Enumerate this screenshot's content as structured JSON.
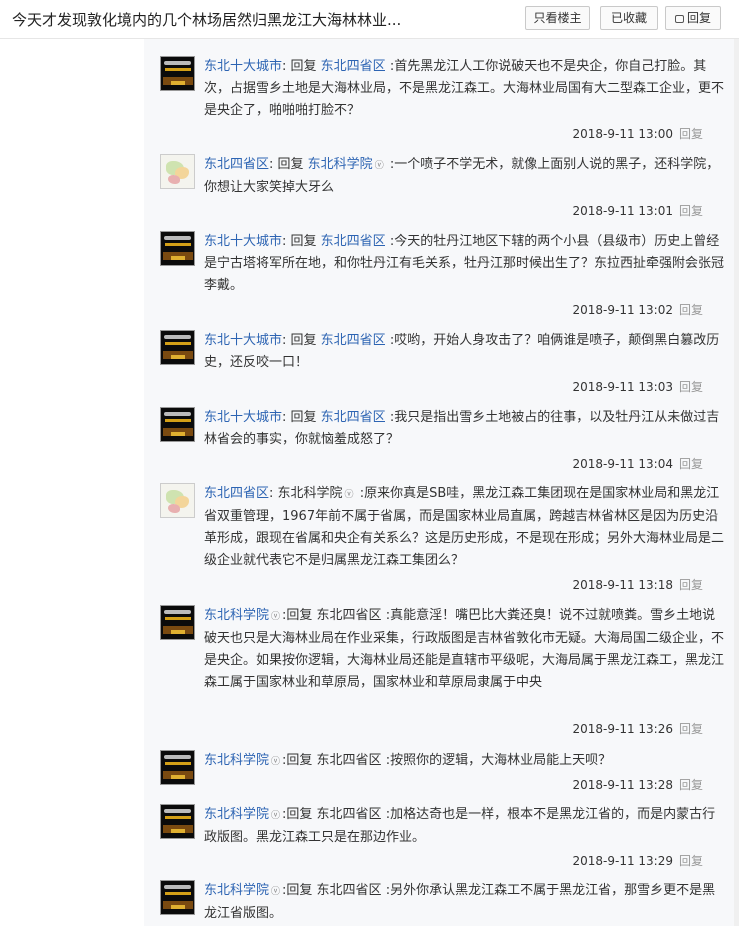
{
  "header": {
    "title": "今天才发现敦化境内的几个林场居然归黑龙江大海林林业...",
    "buttons": {
      "only_owner": "只看楼主",
      "favorited": "已收藏",
      "reply": "回复"
    }
  },
  "comments": [
    {
      "avatar_icon": "dark-night-avatar-icon",
      "name": "东北十大城市",
      "sep": ": ",
      "action": "回复 ",
      "target": "东北四省区",
      "text": " :首先黑龙江人工你说破天也不是央企，你自己打脸。其次，占据雪乡土地是大海林业局，不是黑龙江森工。大海林业局国有大二型森工企业，更不是央企了，啪啪啪打脸不？",
      "time": "2018-9-11 13:00",
      "reply": "回复"
    },
    {
      "avatar_icon": "map-avatar-icon",
      "name": "东北四省区",
      "sep": ": ",
      "action": "回复 ",
      "target": "东北科学院",
      "target_badge": "ⓥ",
      "text": " :一个喷子不学无术，就像上面别人说的黑子，还科学院，你想让大家笑掉大牙么",
      "time": "2018-9-11 13:01",
      "reply": "回复"
    },
    {
      "avatar_icon": "dark-night-avatar-icon",
      "name": "东北十大城市",
      "sep": ": ",
      "action": "回复 ",
      "target": "东北四省区",
      "text": " :今天的牡丹江地区下辖的两个小县（县级市）历史上曾经是宁古塔将军所在地，和你牡丹江有毛关系，牡丹江那时候出生了？东拉西扯牵强附会张冠李戴。",
      "time": "2018-9-11 13:02",
      "reply": "回复"
    },
    {
      "avatar_icon": "dark-night-avatar-icon",
      "name": "东北十大城市",
      "sep": ": ",
      "action": "回复 ",
      "target": "东北四省区",
      "text": " :哎哟，开始人身攻击了？咱俩谁是喷子，颠倒黑白篡改历史，还反咬一口！",
      "time": "2018-9-11 13:03",
      "reply": "回复"
    },
    {
      "avatar_icon": "dark-night-avatar-icon",
      "name": "东北十大城市",
      "sep": ": ",
      "action": "回复 ",
      "target": "东北四省区",
      "text": " :我只是指出雪乡土地被占的往事，以及牡丹江从未做过吉林省会的事实，你就恼羞成怒了？",
      "time": "2018-9-11 13:04",
      "reply": "回复"
    },
    {
      "avatar_icon": "map-avatar-icon",
      "name": "东北四省区",
      "sep": ": ",
      "action": "",
      "target": "东北科学院",
      "target_plain": true,
      "target_badge": "ⓥ",
      "text": " :原来你真是SB哇，黑龙江森工集团现在是国家林业局和黑龙江省双重管理，1967年前不属于省属，而是国家林业局直属，跨越吉林省林区是因为历史沿革形成，跟现在省属和央企有关系么？这是历史形成，不是现在形成；另外大海林业局是二级企业就代表它不是归属黑龙江森工集团么？",
      "time": "2018-9-11 13:18",
      "reply": "回复"
    },
    {
      "avatar_icon": "dark-night-avatar-icon",
      "name": "东北科学院",
      "name_badge": "ⓥ",
      "sep": " ",
      "action": ":回复 ",
      "target": "东北四省区",
      "target_plain": true,
      "text": " :真能意淫！嘴巴比大粪还臭！说不过就喷粪。雪乡土地说破天也只是大海林业局在作业采集，行政版图是吉林省敦化市无疑。大海局国二级企业，不是央企。如果按你逻辑，大海林业局还能是直辖市平级呢，大海局属于黑龙江森工，黑龙江森工属于国家林业和草原局，国家林业和草原局隶属于中央",
      "time": "2018-9-11 13:26",
      "reply": "回复"
    },
    {
      "avatar_icon": "dark-night-avatar-icon",
      "name": "东北科学院",
      "name_badge": "ⓥ",
      "sep": " ",
      "action": ":回复 ",
      "target": "东北四省区",
      "target_plain": true,
      "text": " :按照你的逻辑，大海林业局能上天呗？",
      "time": "2018-9-11 13:28",
      "reply": "回复"
    },
    {
      "avatar_icon": "dark-night-avatar-icon",
      "name": "东北科学院",
      "name_badge": "ⓥ",
      "sep": " ",
      "action": ":回复 ",
      "target": "东北四省区",
      "target_plain": true,
      "text": " :加格达奇也是一样，根本不是黑龙江省的，而是内蒙古行政版图。黑龙江森工只是在那边作业。",
      "time": "2018-9-11 13:29",
      "reply": "回复"
    },
    {
      "avatar_icon": "dark-night-avatar-icon",
      "name": "东北科学院",
      "name_badge": "ⓥ",
      "sep": " ",
      "action": ":回复 ",
      "target": "东北四省区",
      "target_plain": true,
      "text": " :另外你承认黑龙江森工不属于黑龙江省，那雪乡更不是黑龙江省版图。",
      "time": "",
      "reply": ""
    }
  ]
}
